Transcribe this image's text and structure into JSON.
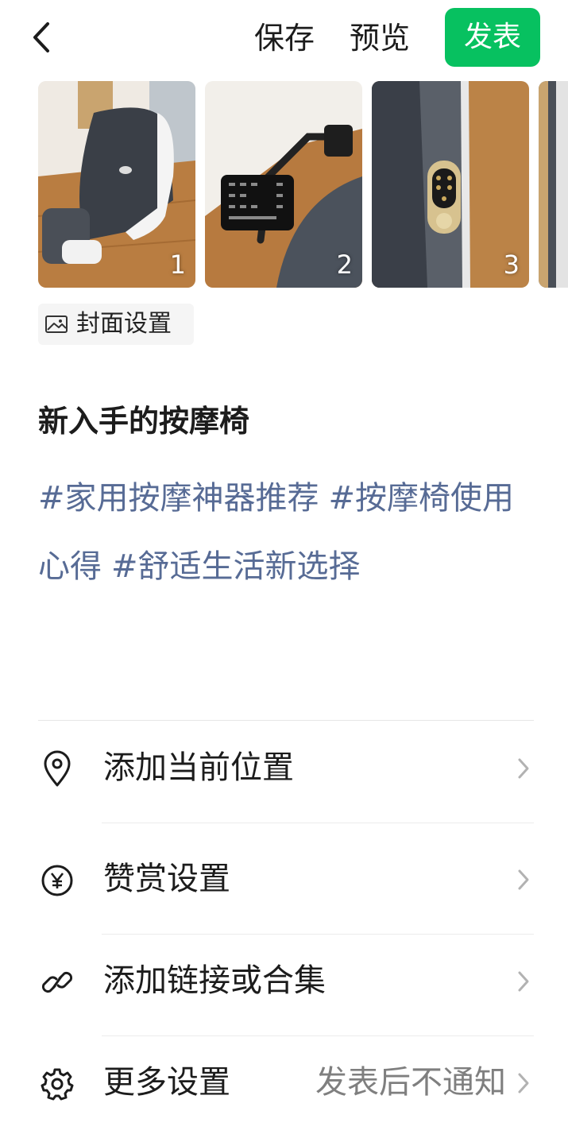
{
  "header": {
    "back_icon": "chevron-left-icon",
    "save_label": "保存",
    "preview_label": "预览",
    "publish_label": "发表",
    "accent_color": "#07c160"
  },
  "images": [
    {
      "index": "1"
    },
    {
      "index": "2"
    },
    {
      "index": "3"
    }
  ],
  "cover": {
    "icon": "image-icon",
    "label": "封面设置"
  },
  "post": {
    "title": "新入手的按摩椅",
    "tags": [
      "#家用按摩神器推荐",
      "#按摩椅使用心得",
      "#舒适生活新选择"
    ],
    "tag_color": "#576b95"
  },
  "settings": [
    {
      "icon": "location-pin-icon",
      "label": "添加当前位置",
      "value": ""
    },
    {
      "icon": "yen-coin-icon",
      "label": "赞赏设置",
      "value": ""
    },
    {
      "icon": "link-icon",
      "label": "添加链接或合集",
      "value": ""
    },
    {
      "icon": "gear-icon",
      "label": "更多设置",
      "value": "发表后不通知"
    }
  ]
}
